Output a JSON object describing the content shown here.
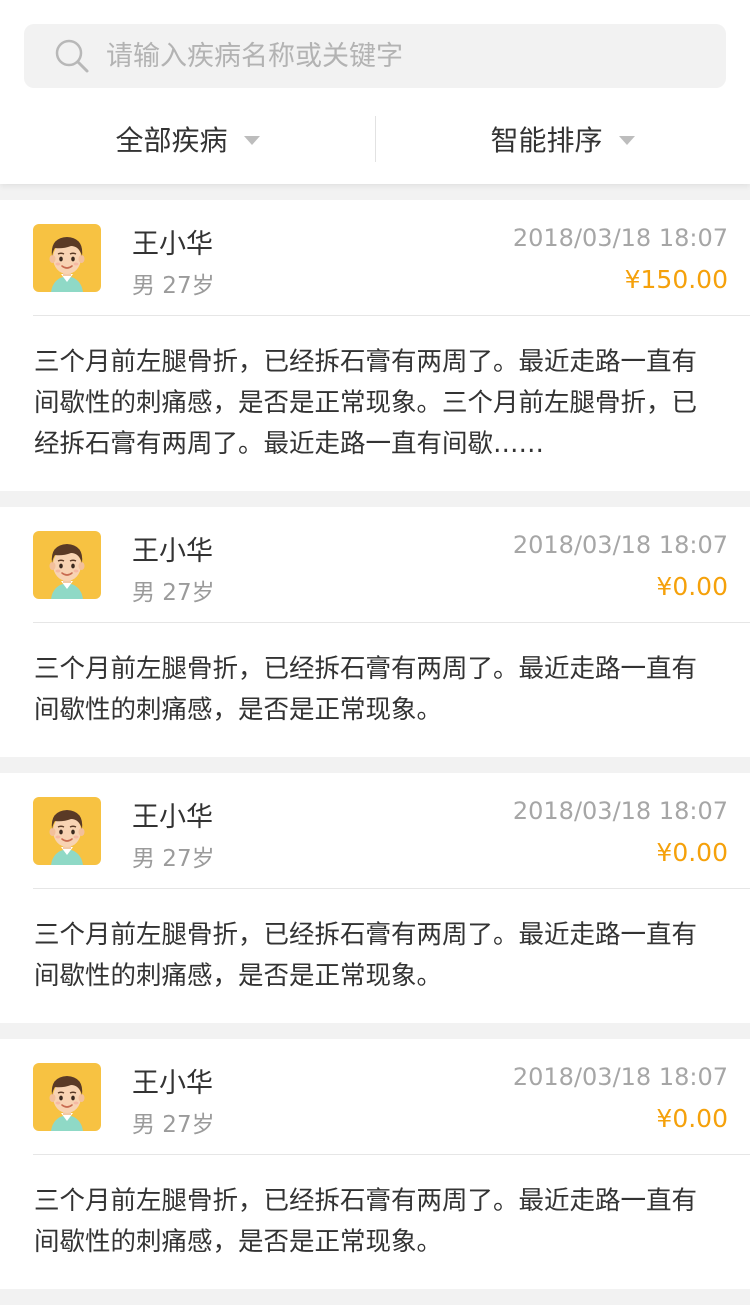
{
  "search": {
    "placeholder": "请输入疾病名称或关键字"
  },
  "filters": [
    {
      "label": "全部疾病"
    },
    {
      "label": "智能排序"
    }
  ],
  "cards": [
    {
      "name": "王小华",
      "meta": "男 27岁",
      "time": "2018/03/18 18:07",
      "price": "¥150.00",
      "content": "三个月前左腿骨折，已经拆石膏有两周了。最近走路一直有间歇性的刺痛感，是否是正常现象。三个月前左腿骨折，已经拆石膏有两周了。最近走路一直有间歇……"
    },
    {
      "name": "王小华",
      "meta": "男 27岁",
      "time": "2018/03/18 18:07",
      "price": "¥0.00",
      "content": "三个月前左腿骨折，已经拆石膏有两周了。最近走路一直有间歇性的刺痛感，是否是正常现象。"
    },
    {
      "name": "王小华",
      "meta": "男 27岁",
      "time": "2018/03/18 18:07",
      "price": "¥0.00",
      "content": "三个月前左腿骨折，已经拆石膏有两周了。最近走路一直有间歇性的刺痛感，是否是正常现象。"
    },
    {
      "name": "王小华",
      "meta": "男 27岁",
      "time": "2018/03/18 18:07",
      "price": "¥0.00",
      "content": "三个月前左腿骨折，已经拆石膏有两周了。最近走路一直有间歇性的刺痛感，是否是正常现象。"
    }
  ],
  "colors": {
    "accent_price": "#f5a10b",
    "avatar_bg": "#f7c242"
  }
}
